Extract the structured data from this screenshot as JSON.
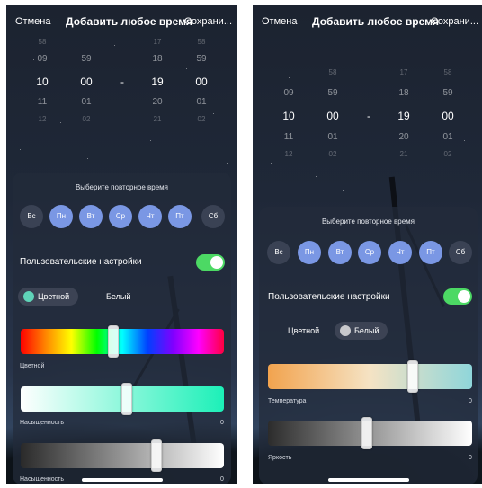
{
  "nav": {
    "cancel": "Отмена",
    "title": "Добавить любое время",
    "save": "Сохрани..."
  },
  "left": {
    "picker": [
      [
        "58",
        "",
        "17",
        "58"
      ],
      [
        "09",
        "59",
        "18",
        "59"
      ],
      [
        "10",
        "00",
        "19",
        "00"
      ],
      [
        "11",
        "01",
        "20",
        "01"
      ],
      [
        "12",
        "02",
        "21",
        "02"
      ]
    ],
    "dash": "-",
    "repeat_hint": "Выберите повторное время",
    "days": [
      {
        "label": "Вс",
        "on": false
      },
      {
        "label": "Пн",
        "on": true
      },
      {
        "label": "Вт",
        "on": true
      },
      {
        "label": "Ср",
        "on": true
      },
      {
        "label": "Чт",
        "on": true
      },
      {
        "label": "Пт",
        "on": true
      },
      {
        "label": "Сб",
        "on": false
      }
    ],
    "custom_settings": "Пользовательские настройки",
    "custom_on": true,
    "mode_color": "Цветной",
    "mode_white": "Белый",
    "mode_selected": "Цветной",
    "slider1_label": "Цветной",
    "slider1_level": 0.45,
    "slider2_label": "Насыщенность",
    "slider2_value": "0",
    "slider2_level": 0.51,
    "slider3_label": "Насыщенность",
    "slider3_value": "0",
    "slider3_level": 0.66
  },
  "right": {
    "picker": [
      [
        "",
        "58",
        "17",
        "58"
      ],
      [
        "09",
        "59",
        "18",
        "59"
      ],
      [
        "10",
        "00",
        "19",
        "00"
      ],
      [
        "11",
        "01",
        "20",
        "01"
      ],
      [
        "12",
        "02",
        "21",
        "02"
      ]
    ],
    "dash": "-",
    "repeat_hint": "Выберите повторное время",
    "days": [
      {
        "label": "Вс",
        "on": false
      },
      {
        "label": "Пн",
        "on": true
      },
      {
        "label": "Вт",
        "on": true
      },
      {
        "label": "Ср",
        "on": true
      },
      {
        "label": "Чт",
        "on": true
      },
      {
        "label": "Пт",
        "on": true
      },
      {
        "label": "Сб",
        "on": false
      }
    ],
    "custom_settings": "Пользовательские настройки",
    "custom_on": true,
    "mode_color": "Цветной",
    "mode_white": "Белый",
    "mode_selected": "Белый",
    "slider1_label": "Температура",
    "slider1_value": "0",
    "slider1_level": 0.71,
    "slider2_label": "Яркость",
    "slider2_value": "0",
    "slider2_level": 0.48
  },
  "colors": {
    "day_on": "#7a97e4",
    "day_off": "#3a4254",
    "toggle_on": "#4cd964",
    "color_dot": "#5fd3b8",
    "white_dot": "#c8c8cc"
  }
}
